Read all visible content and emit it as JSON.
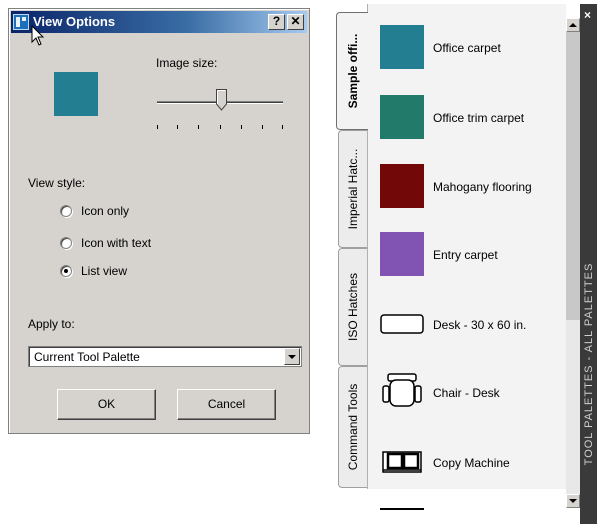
{
  "dialog": {
    "title": "View Options",
    "help_label": "?",
    "close_label": "✕",
    "image_size_label": "Image size:",
    "slider_value_fraction": 0.5,
    "view_style_label": "View style:",
    "view_styles": [
      {
        "label": "Icon only",
        "checked": false
      },
      {
        "label": "Icon with text",
        "checked": false
      },
      {
        "label": "List view",
        "checked": true
      }
    ],
    "apply_to_label": "Apply to:",
    "apply_to_value": "Current Tool Palette",
    "ok_label": "OK",
    "cancel_label": "Cancel",
    "preview_color": "#237e92"
  },
  "palette": {
    "tabs": [
      {
        "label": "Sample offi...",
        "active": true
      },
      {
        "label": "Imperial Hatc...",
        "active": false
      },
      {
        "label": "ISO Hatches",
        "active": false
      },
      {
        "label": "Command Tools",
        "active": false
      }
    ],
    "items": [
      {
        "label": "Office carpet",
        "icon": "swatch",
        "color": "#237e92"
      },
      {
        "label": "Office trim carpet",
        "icon": "swatch",
        "color": "#227a6a"
      },
      {
        "label": "Mahogany flooring",
        "icon": "swatch",
        "color": "#720808"
      },
      {
        "label": "Entry carpet",
        "icon": "swatch",
        "color": "#8153b2"
      },
      {
        "label": "Desk - 30 x 60 in.",
        "icon": "desk-icon"
      },
      {
        "label": "Chair - Desk",
        "icon": "chair-icon"
      },
      {
        "label": "Copy Machine",
        "icon": "copy-machine-icon"
      }
    ],
    "sidebar_title": "TOOL PALETTES - ALL PALETTES",
    "close_label": "×"
  }
}
